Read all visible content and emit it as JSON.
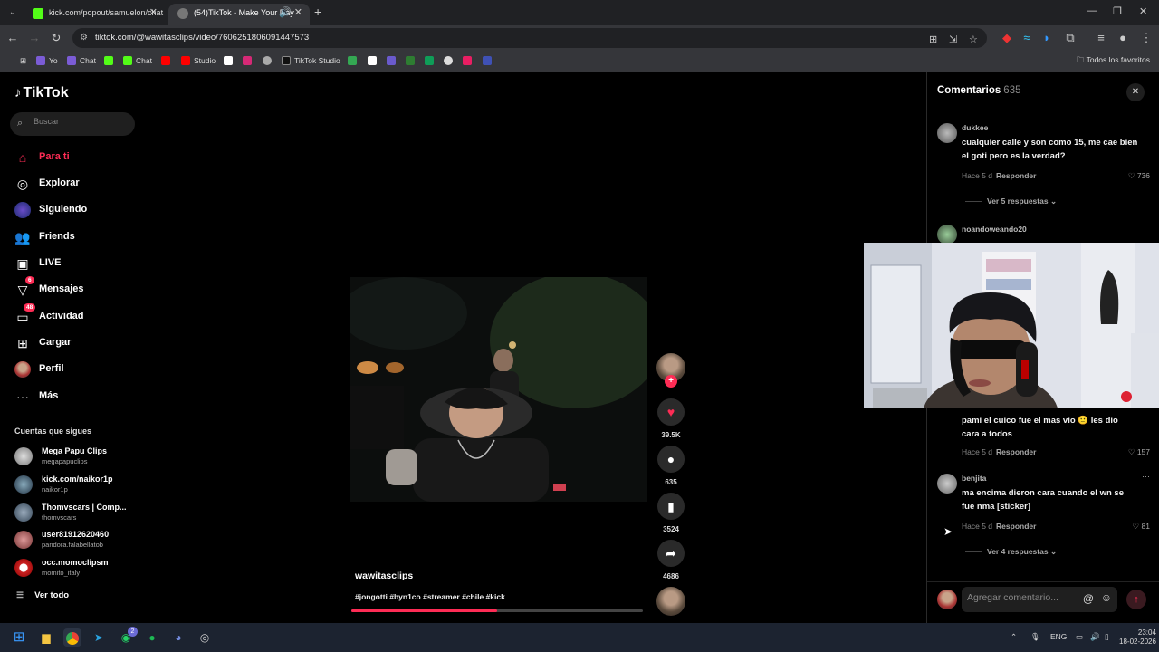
{
  "browser": {
    "tabs": [
      {
        "title": "kick.com/popout/samuelon/chat",
        "icon_color": "#53fc18"
      },
      {
        "title": "(54)TikTok - Make Your Day",
        "icon_color": "#ffffff"
      }
    ],
    "url": "tiktok.com/@wawitasclips/video/7606251806091447573",
    "bookmarks": [
      "Yo",
      "Chat",
      "Chat",
      "Studio",
      "TikTok Studio"
    ],
    "bookmarks_all": "Todos los favoritos"
  },
  "tiktok": {
    "logo": "TikTok",
    "search_placeholder": "Buscar",
    "nav": [
      {
        "label": "Para ti",
        "icon": "home-icon"
      },
      {
        "label": "Explorar",
        "icon": "compass-icon"
      },
      {
        "label": "Siguiendo",
        "icon": "following-icon"
      },
      {
        "label": "Friends",
        "icon": "friends-icon"
      },
      {
        "label": "LIVE",
        "icon": "live-icon"
      },
      {
        "label": "Mensajes",
        "icon": "messages-icon",
        "badge": "6"
      },
      {
        "label": "Actividad",
        "icon": "activity-icon",
        "badge": "48"
      },
      {
        "label": "Cargar",
        "icon": "upload-icon"
      },
      {
        "label": "Perfil",
        "icon": "profile-icon"
      },
      {
        "label": "Más",
        "icon": "more-icon"
      }
    ],
    "following_title": "Cuentas que sigues",
    "following": [
      {
        "name": "Mega Papu Clips",
        "handle": "megapapuclips"
      },
      {
        "name": "kick.com/naikor1p",
        "handle": "naikor1p"
      },
      {
        "name": "Thomvscars | Comp...",
        "handle": "thomvscars"
      },
      {
        "name": "user81912620460",
        "handle": "pandora.falabellatob"
      },
      {
        "name": "occ.momoclipsm",
        "handle": "momito_italy"
      }
    ],
    "see_all": "Ver todo"
  },
  "video": {
    "creator": "wawitasclips",
    "tags": "#jongotti #byn1co #streamer #chile #kick",
    "progress": 0.5,
    "likes": "39.5K",
    "comments": "635",
    "saves": "3524",
    "shares": "4686"
  },
  "comments": {
    "title": "Comentarios",
    "count": "635",
    "items": [
      {
        "user": "dukkee",
        "text": "cualquier calle y son como 15, me cae bien el goti pero es la verdad?",
        "time": "Hace 5 d",
        "reply": "Responder",
        "likes": "736",
        "view_replies": "Ver 5 respuestas"
      },
      {
        "user": "noandoweando20",
        "text": "",
        "time": "",
        "reply": "",
        "likes": "",
        "view_replies": ""
      },
      {
        "user": "",
        "text": "pami el cuico fue el mas vio 🙂 les dio cara a todos",
        "time": "Hace 5 d",
        "reply": "Responder",
        "likes": "157",
        "view_replies": ""
      },
      {
        "user": "benjita",
        "text": "ma encima dieron cara cuando el wn se fue nma [sticker]",
        "time": "Hace 5 d",
        "reply": "Responder",
        "likes": "81",
        "view_replies": "Ver 4 respuestas"
      }
    ],
    "input_placeholder": "Agregar comentario..."
  },
  "taskbar": {
    "lang": "ENG",
    "time": "23:04",
    "date": "18-02-2026",
    "whatsapp_badge": "2"
  }
}
